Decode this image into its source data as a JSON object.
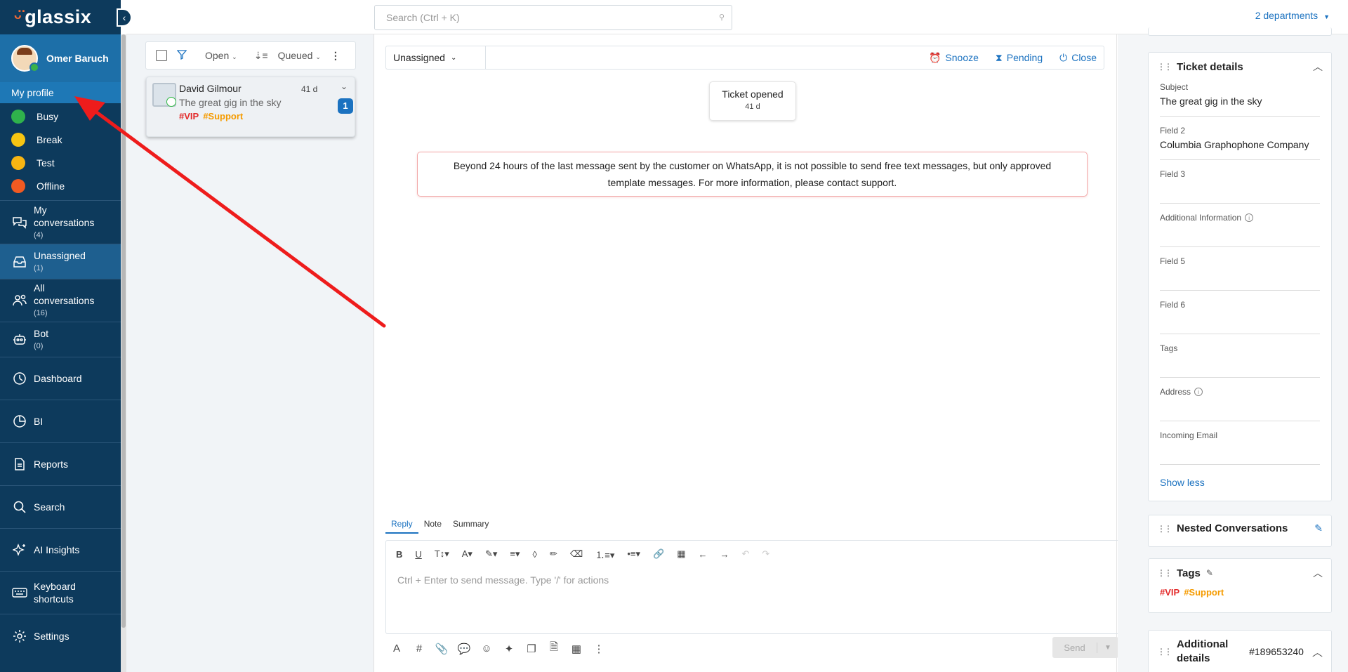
{
  "brand": {
    "name": "glassix",
    "accent": "#f06a35",
    "sidebar_bg": "#0d3a5c",
    "highlight": "#1d6fa8"
  },
  "user": {
    "name": "Omer Baruch",
    "status_color": "#3ab24a"
  },
  "profile_menu": {
    "my_profile": "My profile",
    "statuses": [
      {
        "label": "Busy",
        "color": "#2fb24c"
      },
      {
        "label": "Break",
        "color": "#f7c512"
      },
      {
        "label": "Test",
        "color": "#f7b512"
      },
      {
        "label": "Offline",
        "color": "#f15a22"
      }
    ]
  },
  "nav": [
    {
      "label": "My conversations",
      "count": "(4)",
      "icon": "chat-bubbles-icon"
    },
    {
      "label": "Unassigned",
      "count": "(1)",
      "icon": "inbox-icon",
      "active": true
    },
    {
      "label": "All conversations",
      "count": "(16)",
      "icon": "users-icon"
    },
    {
      "label": "Bot",
      "count": "(0)",
      "icon": "robot-icon"
    },
    {
      "label": "Dashboard",
      "count": "",
      "icon": "gauge-icon"
    },
    {
      "label": "BI",
      "count": "",
      "icon": "pie-chart-icon"
    },
    {
      "label": "Reports",
      "count": "",
      "icon": "document-icon"
    },
    {
      "label": "Search",
      "count": "",
      "icon": "search-icon"
    },
    {
      "label": "AI Insights",
      "count": "",
      "icon": "sparkle-icon"
    },
    {
      "label": "Keyboard shortcuts",
      "count": "",
      "icon": "keyboard-icon"
    },
    {
      "label": "Settings",
      "count": "",
      "icon": "gear-icon"
    }
  ],
  "topbar": {
    "search_placeholder": "Search (Ctrl + K)",
    "departments": "2 departments"
  },
  "list": {
    "filter_open": "Open",
    "filter_queued": "Queued",
    "tickets": [
      {
        "name": "David Gilmour",
        "time": "41 d",
        "subject": "The great gig in the sky",
        "unread": "1",
        "tags": [
          "#VIP",
          "#Support"
        ]
      }
    ]
  },
  "conversation": {
    "assignee": "Unassigned",
    "actions": {
      "snooze": "Snooze",
      "pending": "Pending",
      "close": "Close"
    },
    "opened_label": "Ticket opened",
    "opened_time": "41 d",
    "warning_line1": "Beyond 24 hours of the last message sent by the customer on WhatsApp, it is not possible to send free text messages, but only approved",
    "warning_line2": "template messages. For more information, please contact support.",
    "tabs": [
      "Reply",
      "Note",
      "Summary"
    ],
    "editor_placeholder": "Ctrl + Enter to send message. Type '/' for actions",
    "send_label": "Send"
  },
  "ticket_details": {
    "title": "Ticket details",
    "fields": [
      {
        "label": "Subject",
        "value": "The great gig in the sky"
      },
      {
        "label": "Field 2",
        "value": "Columbia Graphophone Company"
      },
      {
        "label": "Field 3",
        "value": ""
      },
      {
        "label": "Additional Information",
        "value": "",
        "info": true
      },
      {
        "label": "Field 5",
        "value": ""
      },
      {
        "label": "Field 6",
        "value": ""
      },
      {
        "label": "Tags",
        "value": ""
      },
      {
        "label": "Address",
        "value": "",
        "info": true
      },
      {
        "label": "Incoming Email",
        "value": ""
      }
    ],
    "show_less": "Show less"
  },
  "nested": {
    "title": "Nested Conversations"
  },
  "tags_card": {
    "title": "Tags",
    "tags": [
      "#VIP",
      "#Support"
    ]
  },
  "additional": {
    "title_line1": "Additional",
    "title_line2": "details",
    "id": "#189653240"
  }
}
